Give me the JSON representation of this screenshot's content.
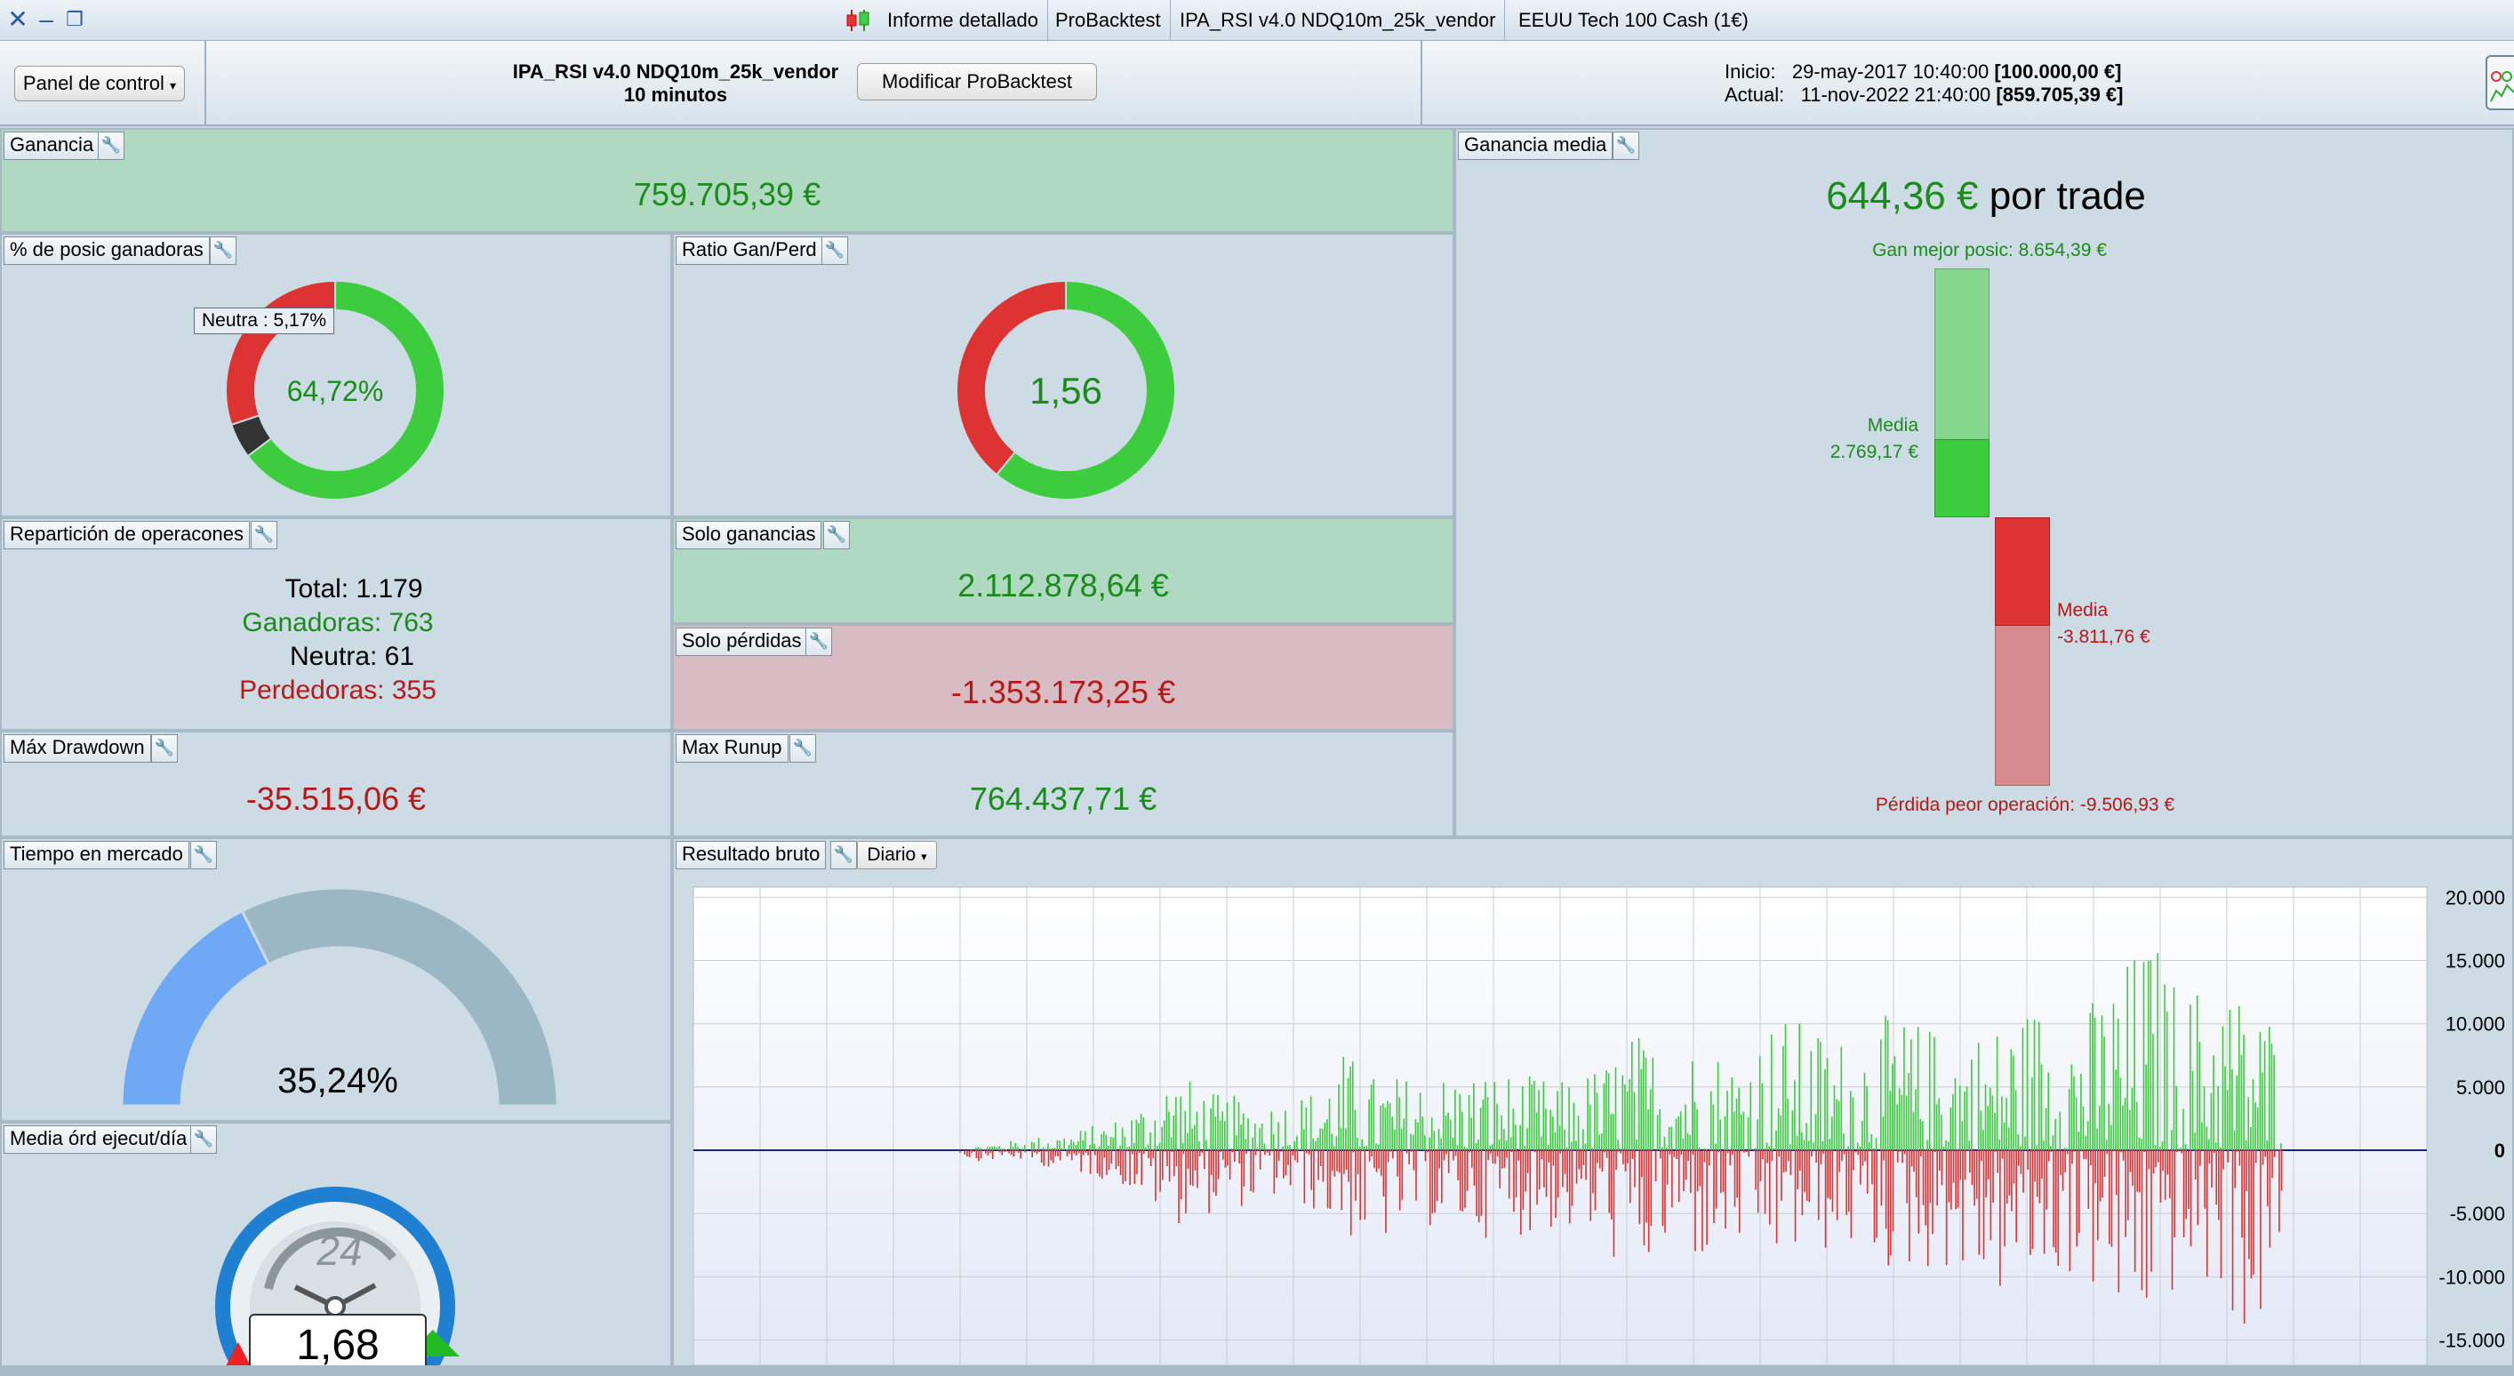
{
  "titlebar": {
    "tabs": [
      "Informe detallado",
      "ProBacktest",
      "IPA_RSI v4.0 NDQ10m_25k_vendor",
      "EEUU Tech 100 Cash (1€)"
    ]
  },
  "toolbar": {
    "panel_menu": "Panel de control",
    "strategy_name": "IPA_RSI v4.0 NDQ10m_25k_vendor",
    "timeframe": "10 minutos",
    "modify_button": "Modificar ProBacktest",
    "start_label": "Inicio:",
    "start_date": "29-may-2017 10:40:00",
    "start_capital": "[100.000,00 €]",
    "current_label": "Actual:",
    "current_date": "11-nov-2022 21:40:00",
    "current_capital": "[859.705,39 €]"
  },
  "ganancia": {
    "label": "Ganancia",
    "value": "759.705,39 €"
  },
  "win_pct": {
    "label": "% de posic ganadoras",
    "value": "64,72%",
    "tooltip": "Neutra : 5,17%",
    "win": 64.72,
    "neutral": 5.17,
    "loss": 30.11
  },
  "ratio": {
    "label": "Ratio Gan/Perd",
    "value": "1,56"
  },
  "ganancia_media": {
    "label": "Ganancia media",
    "value": "644,36 €",
    "suffix": "por trade",
    "best_label": "Gan mejor posic: 8.654,39 €",
    "avg_win_label": "Media",
    "avg_win_value": "2.769,17 €",
    "avg_loss_label": "Media",
    "avg_loss_value": "-3.811,76 €",
    "worst_label": "Pérdida peor operación: -9.506,93 €",
    "best": 8654.39,
    "avg_win": 2769.17,
    "avg_loss": -3811.76,
    "worst": -9506.93
  },
  "reparticion": {
    "label": "Repartición de operacones",
    "total": "Total: 1.179",
    "winners": "Ganadoras: 763",
    "neutral": "Neutra: 61",
    "losers": "Perdedoras: 355"
  },
  "solo_ganancias": {
    "label": "Solo ganancias",
    "value": "2.112.878,64 €"
  },
  "solo_perdidas": {
    "label": "Solo pérdidas",
    "value": "-1.353.173,25 €"
  },
  "drawdown": {
    "label": "Máx Drawdown",
    "value": "-35.515,06 €"
  },
  "runup": {
    "label": "Max Runup",
    "value": "764.437,71 €"
  },
  "tiempo": {
    "label": "Tiempo en mercado",
    "value": "35,24%",
    "fraction": 0.3524
  },
  "media_ord": {
    "label": "Media órd ejecut/día",
    "clock_number": "24",
    "value": "1,68"
  },
  "resultado": {
    "label": "Resultado bruto",
    "period": "Diario"
  },
  "chart_data": {
    "type": "bar",
    "title": "Resultado bruto",
    "ylim": [
      -17000,
      20800
    ],
    "yticks": [
      20000,
      15000,
      10000,
      5000,
      0,
      -5000,
      -10000,
      -15000
    ],
    "ytick_labels": [
      "20.000",
      "15.000",
      "10.000",
      "5.000",
      "0",
      "-5.000",
      "-10.000",
      "-15.000"
    ],
    "grid": true,
    "colors": {
      "positive": "#3dcc3d",
      "negative": "#dd3333",
      "zero_line": "#1a237e"
    },
    "series_envelope": [
      {
        "x": 0.0,
        "pos": 0,
        "neg": 0
      },
      {
        "x": 0.08,
        "pos": 0,
        "neg": 0
      },
      {
        "x": 0.09,
        "pos": 300,
        "neg": -900
      },
      {
        "x": 0.12,
        "pos": 800,
        "neg": -700
      },
      {
        "x": 0.16,
        "pos": 1500,
        "neg": -1800
      },
      {
        "x": 0.19,
        "pos": 2500,
        "neg": -2500
      },
      {
        "x": 0.21,
        "pos": 4000,
        "neg": -4000
      },
      {
        "x": 0.23,
        "pos": 6500,
        "neg": -6000
      },
      {
        "x": 0.26,
        "pos": 4500,
        "neg": -5000
      },
      {
        "x": 0.3,
        "pos": 4000,
        "neg": -4000
      },
      {
        "x": 0.33,
        "pos": 5000,
        "neg": -5000
      },
      {
        "x": 0.35,
        "pos": 8000,
        "neg": -7000
      },
      {
        "x": 0.37,
        "pos": 6000,
        "neg": -8000
      },
      {
        "x": 0.4,
        "pos": 6000,
        "neg": -6000
      },
      {
        "x": 0.45,
        "pos": 6500,
        "neg": -7000
      },
      {
        "x": 0.5,
        "pos": 5500,
        "neg": -6500
      },
      {
        "x": 0.53,
        "pos": 7000,
        "neg": -8000
      },
      {
        "x": 0.55,
        "pos": 9500,
        "neg": -11000
      },
      {
        "x": 0.58,
        "pos": 8000,
        "neg": -8000
      },
      {
        "x": 0.6,
        "pos": 9000,
        "neg": -9500
      },
      {
        "x": 0.62,
        "pos": 7500,
        "neg": -8000
      },
      {
        "x": 0.65,
        "pos": 11000,
        "neg": -9000
      },
      {
        "x": 0.7,
        "pos": 9000,
        "neg": -8000
      },
      {
        "x": 0.73,
        "pos": 11000,
        "neg": -10000
      },
      {
        "x": 0.77,
        "pos": 9500,
        "neg": -9500
      },
      {
        "x": 0.8,
        "pos": 10000,
        "neg": -12000
      },
      {
        "x": 0.83,
        "pos": 12000,
        "neg": -11000
      },
      {
        "x": 0.86,
        "pos": 11000,
        "neg": -10000
      },
      {
        "x": 0.89,
        "pos": 15000,
        "neg": -15000
      },
      {
        "x": 0.91,
        "pos": 17500,
        "neg": -14000
      },
      {
        "x": 0.93,
        "pos": 13000,
        "neg": -11000
      },
      {
        "x": 0.96,
        "pos": 14000,
        "neg": -12000
      },
      {
        "x": 0.98,
        "pos": 12000,
        "neg": -16500
      },
      {
        "x": 1.0,
        "pos": 11000,
        "neg": -9500
      }
    ]
  }
}
